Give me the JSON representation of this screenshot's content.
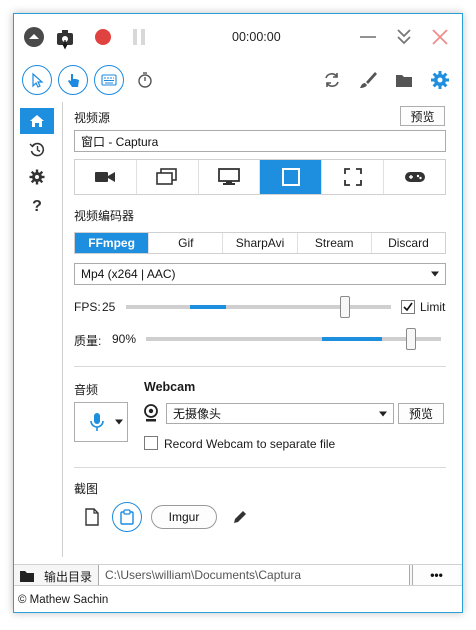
{
  "titlebar": {
    "timer": "00:00:00"
  },
  "toolbar": {},
  "sidebar": {
    "items": [
      {
        "icon": "home-icon"
      },
      {
        "icon": "history-icon"
      },
      {
        "icon": "gear-icon"
      },
      {
        "icon": "help-icon",
        "label": "?"
      }
    ]
  },
  "video_source": {
    "label": "视频源",
    "preview_button": "预览",
    "current_value": "窗口 - Captura"
  },
  "video_encoder": {
    "label": "视频编码器",
    "tabs": [
      "FFmpeg",
      "Gif",
      "SharpAvi",
      "Stream",
      "Discard"
    ],
    "active_tab": "FFmpeg",
    "codec": "Mp4 (x264 | AAC)"
  },
  "fps": {
    "label": "FPS:",
    "value": "25",
    "limit_label": "Limit",
    "limit_checked": true
  },
  "quality": {
    "label": "质量:",
    "value": "90%"
  },
  "audio": {
    "label": "音频"
  },
  "webcam": {
    "label": "Webcam",
    "selected": "无摄像头",
    "preview_button": "预览",
    "separate_file_label": "Record Webcam to separate file",
    "separate_file_checked": false
  },
  "screenshot": {
    "label": "截图",
    "imgur_button": "Imgur"
  },
  "footer": {
    "output_label": "输出目录",
    "output_path": "C:\\Users\\william\\Documents\\Captura",
    "more_button": "•••",
    "copyright": "© Mathew Sachin"
  },
  "colors": {
    "accent": "#1e8fde",
    "record": "#e0433f",
    "close": "#f08c8c"
  }
}
